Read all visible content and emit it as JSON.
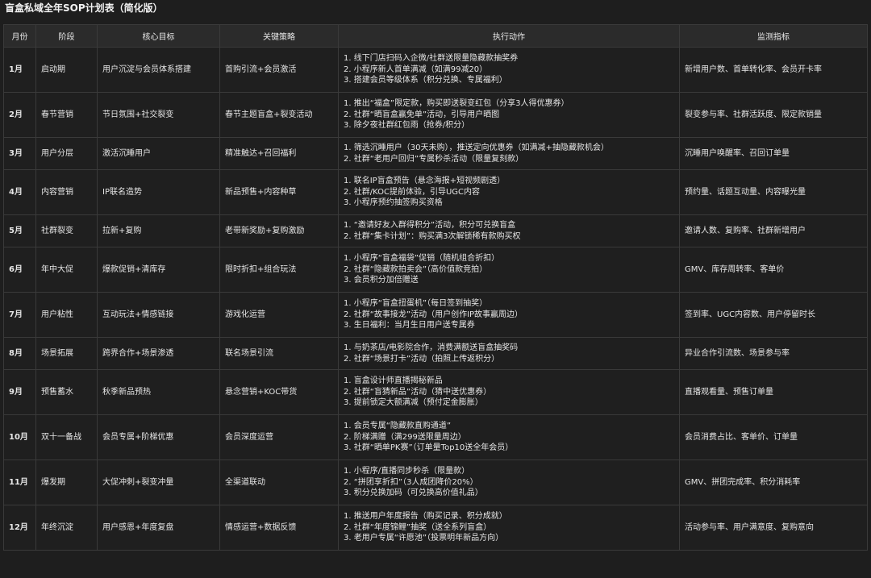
{
  "title": "盲盒私域全年SOP计划表（简化版）",
  "headers": [
    "月份",
    "阶段",
    "核心目标",
    "关键策略",
    "执行动作",
    "监测指标"
  ],
  "rows": [
    {
      "month": "1月",
      "stage": "启动期",
      "goal": "用户沉淀与会员体系搭建",
      "strategy": "首购引流+会员激活",
      "actions": [
        "1. 线下门店扫码入企微/社群送限量隐藏款抽奖券",
        "2. 小程序新人首单满减（如满99减20）",
        "3. 搭建会员等级体系（积分兑换、专属福利）"
      ],
      "metric": "新增用户数、首单转化率、会员开卡率"
    },
    {
      "month": "2月",
      "stage": "春节营销",
      "goal": "节日氛围+社交裂变",
      "strategy": "春节主题盲盒+裂变活动",
      "actions": [
        "1. 推出“福盒”限定款，购买即送裂变红包（分享3人得优惠券）",
        "2. 社群“晒盲盒赢免单”活动，引导用户晒图",
        "3. 除夕夜社群红包雨（抢券/积分）"
      ],
      "metric": "裂变参与率、社群活跃度、限定款销量"
    },
    {
      "month": "3月",
      "stage": "用户分层",
      "goal": "激活沉睡用户",
      "strategy": "精准触达+召回福利",
      "actions": [
        "1. 筛选沉睡用户（30天未购），推送定向优惠券（如满减+抽隐藏款机会）",
        "2. 社群“老用户回归”专属秒杀活动（限量复刻款）"
      ],
      "metric": "沉睡用户唤醒率、召回订单量"
    },
    {
      "month": "4月",
      "stage": "内容营销",
      "goal": "IP联名造势",
      "strategy": "新品预售+内容种草",
      "actions": [
        "1. 联名IP盲盒预告（悬念海报+短视频剧透）",
        "2. 社群/KOC提前体验，引导UGC内容",
        "3. 小程序预约抽签购买资格"
      ],
      "metric": "预约量、话题互动量、内容曝光量"
    },
    {
      "month": "5月",
      "stage": "社群裂变",
      "goal": "拉新+复购",
      "strategy": "老带新奖励+复购激励",
      "actions": [
        "1. “邀请好友入群得积分”活动，积分可兑换盲盒",
        "2. 社群“集卡计划”：购买满3次解锁稀有款购买权"
      ],
      "metric": "邀请人数、复购率、社群新增用户"
    },
    {
      "month": "6月",
      "stage": "年中大促",
      "goal": "爆款促销+清库存",
      "strategy": "限时折扣+组合玩法",
      "actions": [
        "1. 小程序“盲盒福袋”促销（随机组合折扣）",
        "2. 社群“隐藏款拍卖会”（高价值款竞拍）",
        "3. 会员积分加倍赠送"
      ],
      "metric": "GMV、库存周转率、客单价"
    },
    {
      "month": "7月",
      "stage": "用户粘性",
      "goal": "互动玩法+情感链接",
      "strategy": "游戏化运营",
      "actions": [
        "1. 小程序“盲盒扭蛋机”（每日签到抽奖）",
        "2. 社群“故事接龙”活动（用户创作IP故事赢周边）",
        "3. 生日福利：当月生日用户送专属券"
      ],
      "metric": "签到率、UGC内容数、用户停留时长"
    },
    {
      "month": "8月",
      "stage": "场景拓展",
      "goal": "跨界合作+场景渗透",
      "strategy": "联名场景引流",
      "actions": [
        "1. 与奶茶店/电影院合作，消费满额送盲盒抽奖码",
        "2. 社群“场景打卡”活动（拍照上传返积分）"
      ],
      "metric": "异业合作引流数、场景参与率"
    },
    {
      "month": "9月",
      "stage": "预售蓄水",
      "goal": "秋季新品预热",
      "strategy": "悬念营销+KOC带货",
      "actions": [
        "1. 盲盒设计师直播揭秘新品",
        "2. 社群“盲猜新品”活动（猜中送优惠券）",
        "3. 提前锁定大额满减（预付定金膨胀）"
      ],
      "metric": "直播观看量、预售订单量"
    },
    {
      "month": "10月",
      "stage": "双十一备战",
      "goal": "会员专属+阶梯优惠",
      "strategy": "会员深度运营",
      "actions": [
        "1. 会员专属“隐藏款直购通道”",
        "2. 阶梯满赠（满299送限量周边）",
        "3. 社群“晒单PK赛”（订单量Top10送全年会员）"
      ],
      "metric": "会员消费占比、客单价、订单量"
    },
    {
      "month": "11月",
      "stage": "爆发期",
      "goal": "大促冲刺+裂变冲量",
      "strategy": "全渠道联动",
      "actions": [
        "1. 小程序/直播同步秒杀（限量款）",
        "2. “拼团享折扣”（3人成团降价20%）",
        "3. 积分兑换加码（可兑换高价值礼品）"
      ],
      "metric": "GMV、拼团完成率、积分消耗率"
    },
    {
      "month": "12月",
      "stage": "年终沉淀",
      "goal": "用户感恩+年度复盘",
      "strategy": "情感运营+数据反馈",
      "actions": [
        "1. 推送用户年度报告（购买记录、积分成就）",
        "2. 社群“年度锦鲤”抽奖（送全系列盲盒）",
        "3. 老用户专属“许愿池”（投票明年新品方向）"
      ],
      "metric": "活动参与率、用户满意度、复购意向"
    }
  ]
}
